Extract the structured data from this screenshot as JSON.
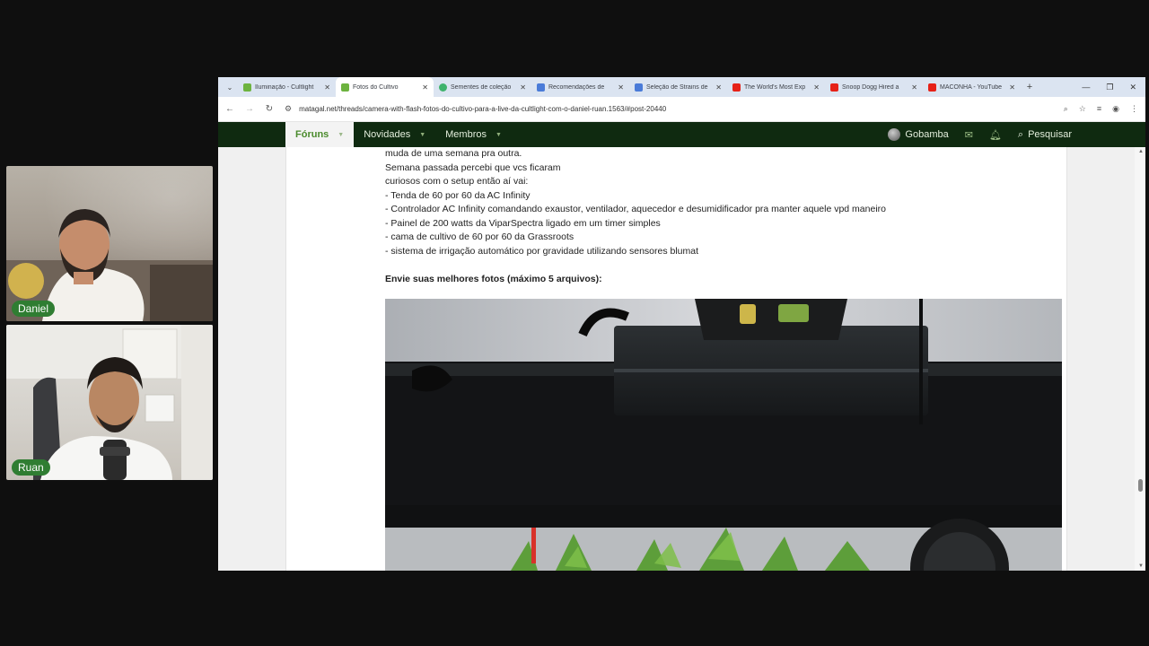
{
  "participants": [
    {
      "name": "Daniel"
    },
    {
      "name": "Ruan"
    }
  ],
  "browser": {
    "tabs": [
      {
        "label": "Iluminação - Cultlight",
        "icon": "leaf-icon",
        "color": "#6db33f"
      },
      {
        "label": "Fotos do Cultivo",
        "icon": "leaf-icon",
        "color": "#6db33f",
        "active": true
      },
      {
        "label": "Sementes de coleção",
        "icon": "leaf-icon",
        "color": "#3fb36d"
      },
      {
        "label": "Recomendações de",
        "icon": "doc-icon",
        "color": "#4a7bd8"
      },
      {
        "label": "Seleção de Strains de",
        "icon": "doc-icon",
        "color": "#4a7bd8"
      },
      {
        "label": "The World's Most Exp",
        "icon": "youtube-icon",
        "color": "#e62117"
      },
      {
        "label": "Snoop Dogg Hired a",
        "icon": "youtube-icon",
        "color": "#e62117"
      },
      {
        "label": "MACONHA - YouTube",
        "icon": "youtube-icon",
        "color": "#e62117"
      }
    ],
    "new_tab": "+",
    "window_controls": {
      "minimize": "—",
      "restore": "❐",
      "close": "✕"
    },
    "url": "matagal.net/threads/camera-with-flash-fotos-do-cultivo-para-a-live-da-cultlight-com-o-daniel-ruan.1563/#post-20440"
  },
  "site": {
    "nav": [
      {
        "label": "Fóruns",
        "active": true
      },
      {
        "label": "Novidades"
      },
      {
        "label": "Membros"
      }
    ],
    "username": "Gobamba",
    "search_label": "Pesquisar",
    "accent": "#4a8b2c",
    "nav_bg": "#0f2a10"
  },
  "post": {
    "lines": [
      "muda de uma semana pra outra.",
      "Semana passada percebi que vcs ficaram",
      "curiosos com o setup então aí vai:",
      "- Tenda de 60 por 60 da AC Infinity",
      "- Controlador AC Infinity comandando exaustor, ventilador, aquecedor e desumidificador pra manter aquele vpd maneiro",
      "- Painel de 200 watts da ViparSpectra ligado em um timer simples",
      "- cama de cultivo de 60 por 60 da Grassroots",
      "- sistema de irrigação automático por gravidade utilizando sensores blumat"
    ],
    "heading": "Envie suas melhores fotos (máximo 5 arquivos):"
  }
}
